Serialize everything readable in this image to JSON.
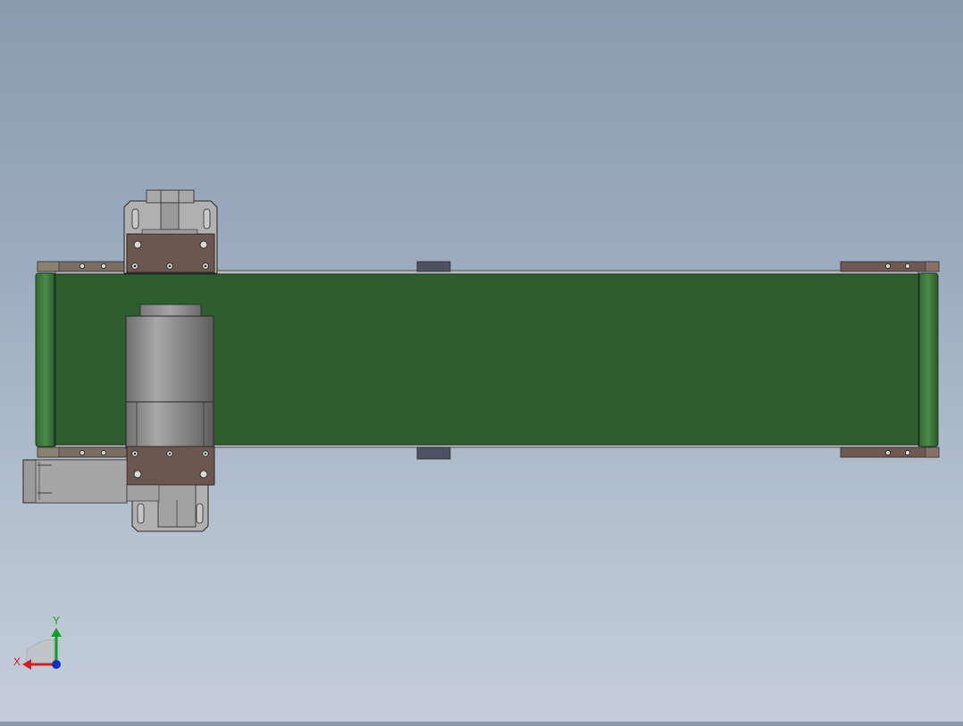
{
  "viewport": {
    "background_top": "#8a9bb0",
    "background_bottom": "#c4ceda"
  },
  "model": {
    "belt_color": "#2e5e2e",
    "roller_color": "#3f7a3f",
    "bracket_color": "#6b5650",
    "motor_color": "#8a8a8a",
    "frame_color": "#6e6a66"
  },
  "triad": {
    "x_label": "X",
    "y_label": "Y",
    "x_color": "#d02020",
    "y_color": "#10a020",
    "z_color": "#1030c0"
  }
}
